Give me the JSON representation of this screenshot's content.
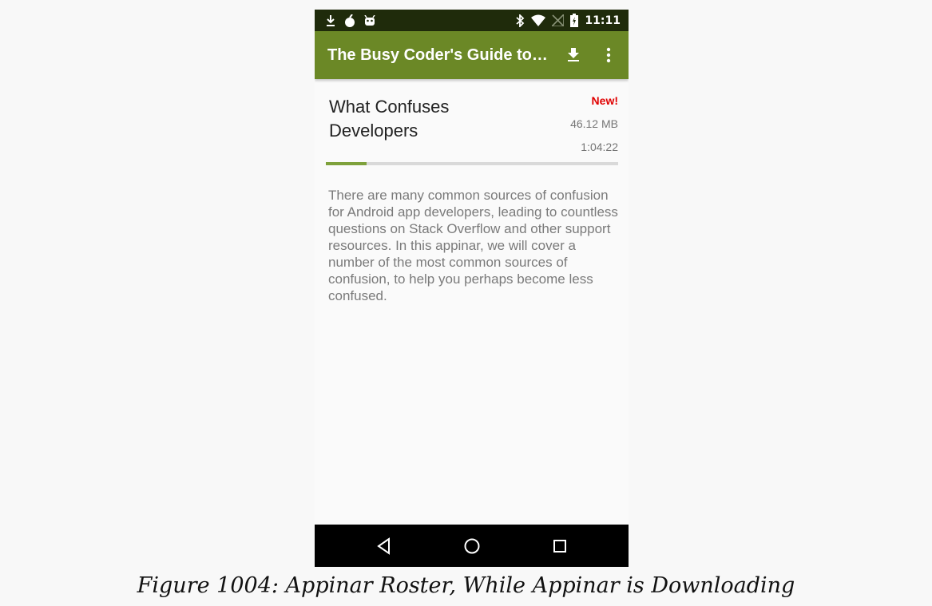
{
  "status_bar": {
    "time": "11:11",
    "left_icons": [
      "download-notification-icon",
      "bomb-icon",
      "android-bot-icon"
    ],
    "right_icons": [
      "bluetooth-icon",
      "wifi-icon",
      "no-signal-icon",
      "battery-charging-icon"
    ]
  },
  "app_bar": {
    "title": "The Busy Coder's Guide to…",
    "actions": [
      "download-icon",
      "overflow-menu-icon"
    ],
    "color": "#6b8826"
  },
  "item": {
    "title": "What Confuses Developers",
    "badge": "New!",
    "size": "46.12 MB",
    "duration": "1:04:22",
    "download_progress": 0.14,
    "description": "There are many common sources of confusion for Android app developers, leading to countless questions on Stack Overflow and other support resources. In this appinar, we will cover a number of the most common sources of confusion, to help you perhaps become less confused."
  },
  "nav_bar": {
    "buttons": [
      "back-icon",
      "home-icon",
      "recents-icon"
    ]
  },
  "caption": "Figure 1004: Appinar Roster, While Appinar is Downloading"
}
